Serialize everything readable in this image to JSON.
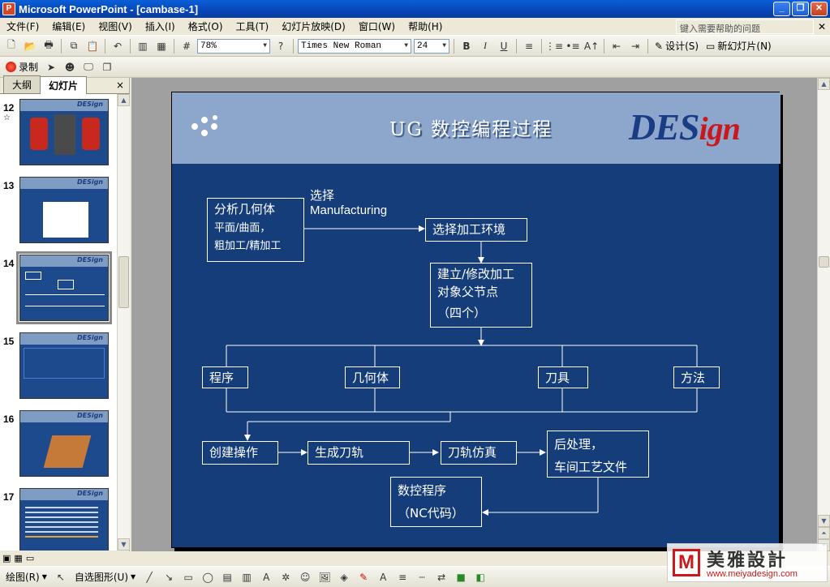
{
  "window": {
    "title": "Microsoft PowerPoint - [cambase-1]"
  },
  "menu": {
    "items": [
      "文件(F)",
      "编辑(E)",
      "视图(V)",
      "插入(I)",
      "格式(O)",
      "工具(T)",
      "幻灯片放映(D)",
      "窗口(W)",
      "帮助(H)"
    ],
    "help_placeholder": "键入需要帮助的问题"
  },
  "toolbar": {
    "zoom": "78%",
    "font": "Times New Roman",
    "size": "24",
    "bold": "B",
    "italic": "I",
    "underline": "U",
    "design_label": "设计(S)",
    "new_slide_label": "新幻灯片(N)",
    "record_label": "录制"
  },
  "pane": {
    "tabs": [
      "大纲",
      "幻灯片"
    ],
    "close": "×",
    "thumbnails": [
      {
        "num": "12"
      },
      {
        "num": "13"
      },
      {
        "num": "14"
      },
      {
        "num": "15"
      },
      {
        "num": "16"
      },
      {
        "num": "17"
      }
    ],
    "thumb_logo": "DESign"
  },
  "slide": {
    "title": "UG 数控编程过程",
    "logo_main": "DES",
    "logo_tail": "ign",
    "boxes": {
      "analyze_title": "分析几何体",
      "analyze_line2": "平面/曲面，",
      "analyze_line3": "粗加工/精加工",
      "select_label_1": "选择",
      "select_label_2": "Manufacturing",
      "choose_env": "选择加工环境",
      "parent_line1": "建立/修改加工",
      "parent_line2": "对象父节点",
      "parent_line3": "（四个）",
      "program": "程序",
      "geometry": "几何体",
      "tool": "刀具",
      "method": "方法",
      "create_op": "创建操作",
      "gen_path": "生成刀轨",
      "simulate": "刀轨仿真",
      "post_line1": "后处理，",
      "post_line2": "车间工艺文件",
      "nc_line1": "数控程序",
      "nc_line2": "（NC代码）"
    }
  },
  "drawbar": {
    "draw_label": "绘图(R)",
    "autoshape_label": "自选图形(U)"
  },
  "watermark": {
    "mark": "M",
    "cn": "美雅設計",
    "url": "www.meiyadesign.com"
  }
}
